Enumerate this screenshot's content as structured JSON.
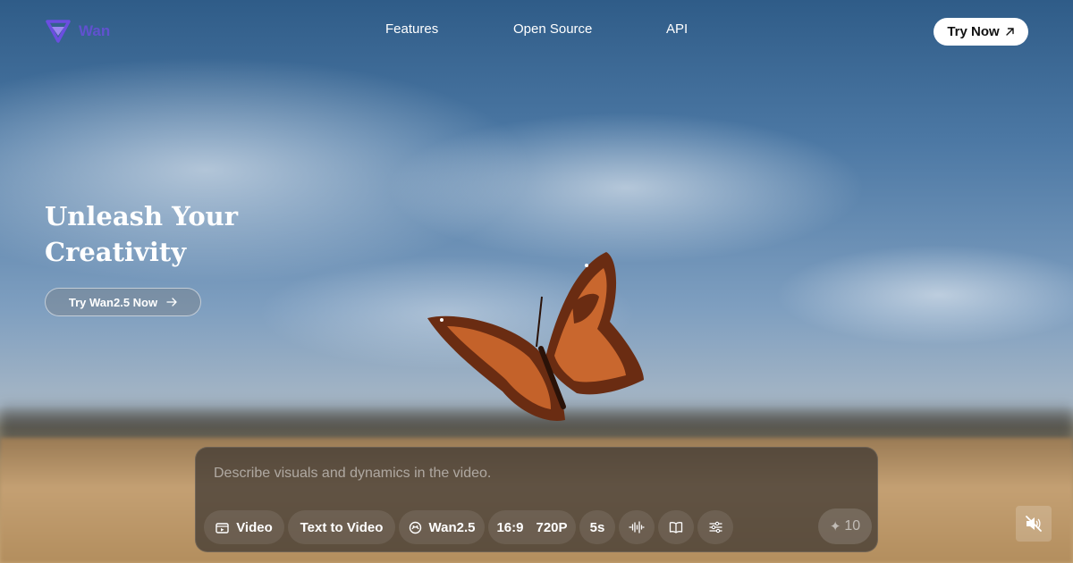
{
  "brand": {
    "name": "Wan"
  },
  "nav": {
    "items": [
      {
        "label": "Features"
      },
      {
        "label": "Open Source"
      },
      {
        "label": "API"
      }
    ],
    "cta_label": "Try Now",
    "cta_icon": "arrow-up-right-icon"
  },
  "hero": {
    "title_line1": "Unleash Your",
    "title_line2": "Creativity",
    "cta_label": "Try Wan2.5 Now",
    "cta_icon": "arrow-right-icon"
  },
  "prompt_panel": {
    "placeholder": "Describe visuals and dynamics in the video.",
    "chips": {
      "mode": {
        "label": "Video",
        "icon": "video-icon"
      },
      "task": {
        "label": "Text to Video"
      },
      "model": {
        "label": "Wan2.5",
        "icon": "model-icon"
      },
      "aspect_ratio": {
        "label": "16:9"
      },
      "resolution": {
        "label": "720P"
      },
      "duration": {
        "label": "5s"
      },
      "audio": {
        "icon": "audio-wave-icon"
      },
      "guide": {
        "icon": "book-icon"
      },
      "settings": {
        "icon": "sliders-icon"
      }
    },
    "credits": {
      "value": "10",
      "icon": "sparkle-icon"
    }
  },
  "video_controls": {
    "mute_icon": "mute-icon"
  },
  "colors": {
    "brand": "#6b4ee0",
    "panel_bg": "#3a3430"
  }
}
